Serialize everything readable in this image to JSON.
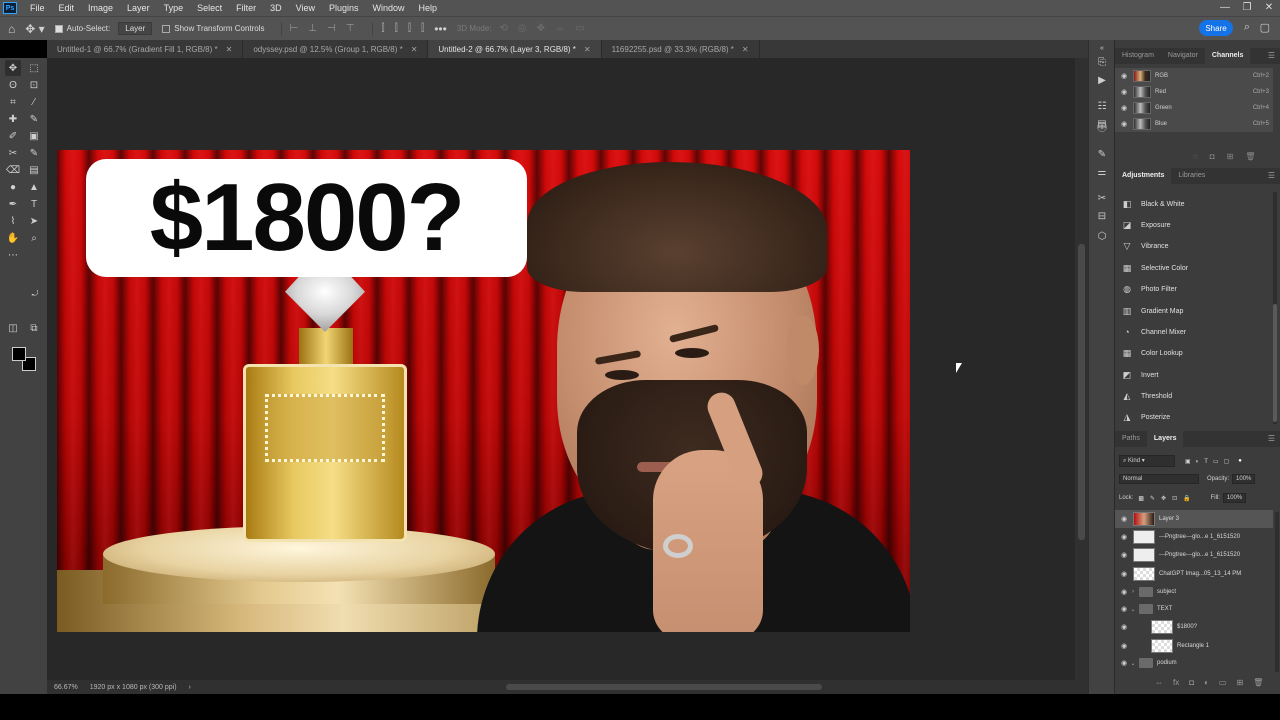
{
  "app": {
    "logo": "Ps"
  },
  "menu": [
    "File",
    "Edit",
    "Image",
    "Layer",
    "Type",
    "Select",
    "Filter",
    "3D",
    "View",
    "Plugins",
    "Window",
    "Help"
  ],
  "window_controls": {
    "minimize": "—",
    "restore": "❐",
    "close": "✕"
  },
  "options": {
    "auto_select_label": "Auto-Select:",
    "auto_select_target": "Layer",
    "show_transform_label": "Show Transform Controls",
    "mode_3d": "3D Mode:",
    "share_label": "Share"
  },
  "tabs": [
    {
      "label": "Untitled-1 @ 66.7% (Gradient Fill 1, RGB/8) *",
      "active": false
    },
    {
      "label": "odyssey.psd @ 12.5% (Group 1, RGB/8) *",
      "active": false
    },
    {
      "label": "Untitled-2 @ 66.7% (Layer 3, RGB/8) *",
      "active": true
    },
    {
      "label": "11692255.psd @ 33.3% (RGB/8) *",
      "active": false
    }
  ],
  "document": {
    "price_text": "$1800?"
  },
  "status": {
    "zoom": "66.67%",
    "doc_size": "1920 px x 1080 px (300 ppi)",
    "arrow": "›"
  },
  "channels_panel": {
    "tabs": [
      "Histogram",
      "Navigator",
      "Channels"
    ],
    "active_tab": "Channels",
    "channels": [
      {
        "name": "RGB",
        "shortcut": "Ctrl+2"
      },
      {
        "name": "Red",
        "shortcut": "Ctrl+3"
      },
      {
        "name": "Green",
        "shortcut": "Ctrl+4"
      },
      {
        "name": "Blue",
        "shortcut": "Ctrl+5"
      }
    ]
  },
  "adjustments_panel": {
    "tabs": [
      "Adjustments",
      "Libraries"
    ],
    "active_tab": "Adjustments",
    "items": [
      "Black & White",
      "Exposure",
      "Vibrance",
      "Selective Color",
      "Photo Filter",
      "Gradient Map",
      "Channel Mixer",
      "Color Lookup",
      "Invert",
      "Threshold",
      "Posterize"
    ]
  },
  "layers_panel": {
    "tabs": [
      "Paths",
      "Layers"
    ],
    "active_tab": "Layers",
    "filter_kind": "Kind",
    "blend_mode": "Normal",
    "opacity_label": "Opacity:",
    "opacity_value": "100%",
    "lock_label": "Lock:",
    "fill_label": "Fill:",
    "fill_value": "100%",
    "layers": [
      {
        "name": "Layer 3",
        "type": "photo",
        "selected": true
      },
      {
        "name": "---Pngtree---glo...e 1_6151520",
        "type": "smart"
      },
      {
        "name": "---Pngtree---glo...e 1_6151520",
        "type": "smart"
      },
      {
        "name": "ChatGPT Imag...05_13_14 PM",
        "type": "smart"
      },
      {
        "name": "subject",
        "type": "group",
        "expanded": false
      },
      {
        "name": "TEXT",
        "type": "group",
        "expanded": true
      },
      {
        "name": "$1800?",
        "type": "smart",
        "indent": true
      },
      {
        "name": "Rectangle 1",
        "type": "smart",
        "indent": true
      },
      {
        "name": "podium",
        "type": "group",
        "expanded": true
      }
    ]
  },
  "colors": {
    "accent": "#1473e6",
    "chrome": "#535353",
    "canvas_bg": "#282828",
    "curtain_red": "#c00808"
  }
}
